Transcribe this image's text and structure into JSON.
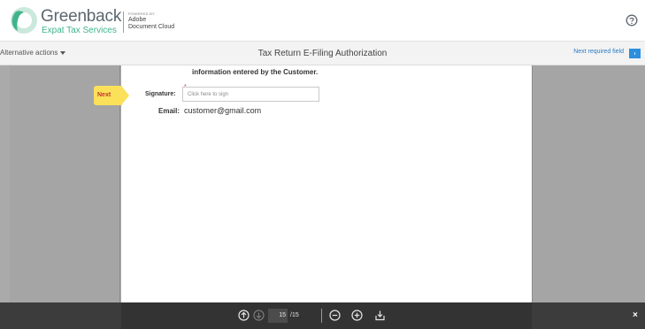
{
  "header": {
    "brand_name": "Greenback",
    "brand_subtitle": "Expat Tax Services",
    "powered_by": "POWERED BY",
    "adobe_line1": "Adobe",
    "adobe_line2": "Document Cloud"
  },
  "toolbar": {
    "alternative_actions": "Alternative actions",
    "document_title": "Tax Return E-Filing Authorization",
    "next_required_field": "Next required field"
  },
  "document": {
    "top_text": "information entered by the Customer.",
    "next_tag": "Next",
    "signature_label": "Signature:",
    "signature_placeholder": "Click here to sign",
    "required_mark": "*",
    "email_label": "Email:",
    "email_value": "customer@gmail.com"
  },
  "pager": {
    "current_page": "15",
    "total_pages": "/15"
  },
  "close_label": "×",
  "colors": {
    "brand_green": "#3fb48a",
    "link_blue": "#2b7bc4",
    "next_tag_yellow": "#fbe05a"
  }
}
